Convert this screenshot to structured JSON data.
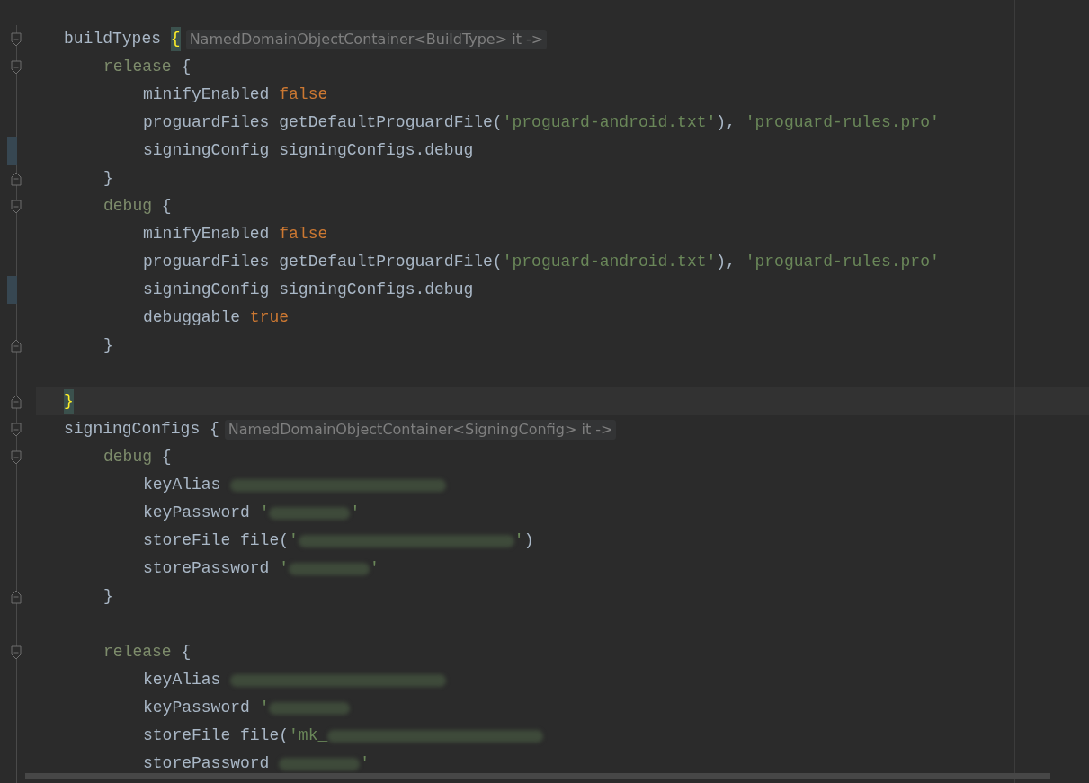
{
  "editor": {
    "lines": [
      {
        "kind": "block",
        "open": [
          {
            "kind": "plain",
            "text": "buildTypes "
          },
          {
            "kind": "brace-match",
            "text": "{"
          },
          {
            "kind": "hint",
            "text": "NamedDomainObjectContainer<BuildType> it ->"
          }
        ],
        "close_current": true,
        "close": [
          {
            "kind": "brace-match",
            "text": "}"
          }
        ],
        "children": [
          {
            "kind": "block",
            "open": [
              {
                "kind": "name",
                "text": "release"
              },
              {
                "kind": "plain",
                "text": " {"
              }
            ],
            "close": [
              {
                "kind": "plain",
                "text": "}"
              }
            ],
            "children": [
              {
                "kind": "line",
                "tokens": [
                  {
                    "kind": "plain",
                    "text": "minifyEnabled "
                  },
                  {
                    "kind": "keyword",
                    "text": "false"
                  }
                ]
              },
              {
                "kind": "line",
                "tokens": [
                  {
                    "kind": "plain",
                    "text": "proguardFiles getDefaultProguardFile("
                  },
                  {
                    "kind": "string",
                    "text": "'proguard-android.txt'"
                  },
                  {
                    "kind": "plain",
                    "text": "), "
                  },
                  {
                    "kind": "string",
                    "text": "'proguard-rules.pro'"
                  }
                ]
              },
              {
                "kind": "line",
                "changed": true,
                "tokens": [
                  {
                    "kind": "plain",
                    "text": "signingConfig signingConfigs.debug"
                  }
                ]
              }
            ]
          },
          {
            "kind": "block",
            "open": [
              {
                "kind": "name",
                "text": "debug"
              },
              {
                "kind": "plain",
                "text": " {"
              }
            ],
            "close": [
              {
                "kind": "plain",
                "text": "}"
              }
            ],
            "children": [
              {
                "kind": "line",
                "tokens": [
                  {
                    "kind": "plain",
                    "text": "minifyEnabled "
                  },
                  {
                    "kind": "keyword",
                    "text": "false"
                  }
                ]
              },
              {
                "kind": "line",
                "tokens": [
                  {
                    "kind": "plain",
                    "text": "proguardFiles getDefaultProguardFile("
                  },
                  {
                    "kind": "string",
                    "text": "'proguard-android.txt'"
                  },
                  {
                    "kind": "plain",
                    "text": "), "
                  },
                  {
                    "kind": "string",
                    "text": "'proguard-rules.pro'"
                  }
                ]
              },
              {
                "kind": "line",
                "changed": true,
                "tokens": [
                  {
                    "kind": "plain",
                    "text": "signingConfig signingConfigs.debug"
                  }
                ]
              },
              {
                "kind": "line",
                "tokens": [
                  {
                    "kind": "plain",
                    "text": "debuggable "
                  },
                  {
                    "kind": "keyword",
                    "text": "true"
                  }
                ]
              }
            ]
          },
          {
            "kind": "blank"
          }
        ]
      },
      {
        "kind": "block",
        "open": [
          {
            "kind": "plain",
            "text": "signingConfigs {"
          },
          {
            "kind": "hint",
            "text": "NamedDomainObjectContainer<SigningConfig> it ->"
          }
        ],
        "children": [
          {
            "kind": "block",
            "open": [
              {
                "kind": "name",
                "text": "debug"
              },
              {
                "kind": "plain",
                "text": " {"
              }
            ],
            "close": [
              {
                "kind": "plain",
                "text": "}"
              }
            ],
            "children": [
              {
                "kind": "line",
                "tokens": [
                  {
                    "kind": "plain",
                    "text": "keyAlias "
                  },
                  {
                    "kind": "blur-long"
                  }
                ]
              },
              {
                "kind": "line",
                "tokens": [
                  {
                    "kind": "plain",
                    "text": "keyPassword "
                  },
                  {
                    "kind": "string",
                    "text": "'"
                  },
                  {
                    "kind": "blur-short"
                  },
                  {
                    "kind": "string",
                    "text": "'"
                  }
                ]
              },
              {
                "kind": "line",
                "tokens": [
                  {
                    "kind": "plain",
                    "text": "storeFile file("
                  },
                  {
                    "kind": "string",
                    "text": "'"
                  },
                  {
                    "kind": "blur-long"
                  },
                  {
                    "kind": "string",
                    "text": "'"
                  },
                  {
                    "kind": "plain",
                    "text": ")"
                  }
                ]
              },
              {
                "kind": "line",
                "tokens": [
                  {
                    "kind": "plain",
                    "text": "storePassword "
                  },
                  {
                    "kind": "string",
                    "text": "'"
                  },
                  {
                    "kind": "blur-short"
                  },
                  {
                    "kind": "string",
                    "text": "'"
                  }
                ]
              }
            ]
          },
          {
            "kind": "blank"
          },
          {
            "kind": "block",
            "open": [
              {
                "kind": "name",
                "text": "release"
              },
              {
                "kind": "plain",
                "text": " {"
              }
            ],
            "children": [
              {
                "kind": "line",
                "tokens": [
                  {
                    "kind": "plain",
                    "text": "keyAlias "
                  },
                  {
                    "kind": "blur-long"
                  }
                ]
              },
              {
                "kind": "line",
                "tokens": [
                  {
                    "kind": "plain",
                    "text": "keyPassword "
                  },
                  {
                    "kind": "string",
                    "text": "'"
                  },
                  {
                    "kind": "blur-short"
                  }
                ]
              },
              {
                "kind": "line",
                "tokens": [
                  {
                    "kind": "plain",
                    "text": "storeFile file("
                  },
                  {
                    "kind": "string",
                    "text": "'mk_"
                  },
                  {
                    "kind": "blur-long"
                  }
                ]
              },
              {
                "kind": "line",
                "tokens": [
                  {
                    "kind": "plain",
                    "text": "storePassword "
                  },
                  {
                    "kind": "blur-short"
                  },
                  {
                    "kind": "string",
                    "text": "'"
                  }
                ]
              }
            ]
          }
        ]
      }
    ]
  }
}
